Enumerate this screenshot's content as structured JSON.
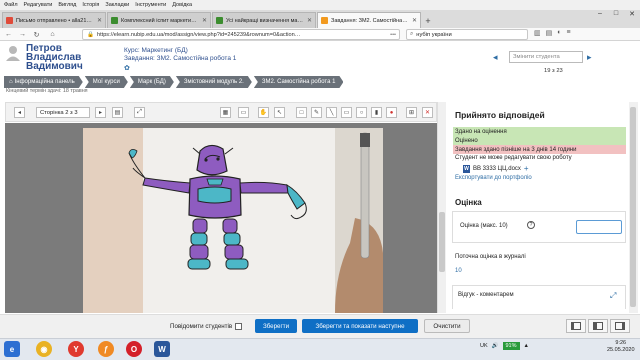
{
  "browser_menu": [
    "Файл",
    "Редагувати",
    "Вигляд",
    "Історія",
    "Закладки",
    "Інструменти",
    "Довідка"
  ],
  "tabs": [
    {
      "label": "Письмо отправлено • alla21…",
      "active": false,
      "favicon_color": "#e04b3a"
    },
    {
      "label": "Комплексний іспит маркетин…",
      "active": false,
      "favicon_color": "#3c8d2f"
    },
    {
      "label": "Усі найкращі визначення марк…",
      "active": false,
      "favicon_color": "#3c8d2f"
    },
    {
      "label": "Завдання: ЗМ2. Самостійна р…",
      "active": true,
      "favicon_color": "#f29a1f"
    }
  ],
  "window_controls": [
    "–",
    "□",
    "✕"
  ],
  "url": "https://elearn.nubip.edu.ua/mod/assign/view.php?id=245239&rownum=0&action…",
  "url_more": "•••",
  "search_text": "нубіп україни",
  "user": {
    "name": "Петров Владислав Вадимович"
  },
  "course_line": "Курс: Маркетинг (БД)",
  "task_line": "Завдання: ЗМ2. Самостійна робота 1",
  "student_select_placeholder": "Змінити студента",
  "page_counter": "19 з 23",
  "breadcrumbs": [
    "Інформаційна панель",
    "Мої курси",
    "Марк (БД)",
    "Змістовний модуль 2.",
    "ЗМ2. Самостійна робота 1"
  ],
  "cut_line": "Кінцевий термін здачі: 18 травня",
  "pdf_toolbar": {
    "page_label": "Сторінка 2 з 3"
  },
  "right_panel": {
    "title": "Прийнято відповідей",
    "status_submitted": "Здано на оцінення",
    "status_graded": "Оцінено",
    "status_late": "Завдання здано пізніше на 3 днів 14 години",
    "cannot_edit": "Студент не може редагувати свою роботу",
    "file_name": "ВВ 3333 ЦЦ.docx",
    "export_link": "Експортувати до портфоліо",
    "grade_title": "Оцінка",
    "grade_label": "Оцінка (макс. 10)",
    "current_grade_label": "Поточна оцінка в журналі",
    "current_grade_value": "10",
    "feedback_label": "Відгук - коментарем"
  },
  "bottom": {
    "notify_label": "Повідомити студентів",
    "save_label": "Зберегти",
    "save_next_label": "Зберегти та показати наступне",
    "reset_label": "Очистити"
  },
  "taskbar": {
    "apps": [
      "Internet Explorer",
      "Chrome",
      "Yandex",
      "Firefox",
      "Opera",
      "Word"
    ],
    "lang": "UK",
    "battery": "91%",
    "time": "9:26",
    "date": "25.05.2020"
  },
  "colors": {
    "primary_button": "#0f6fc5",
    "link": "#2e6da4",
    "status_ok": "#c8e6b5",
    "status_late": "#f2c1c1"
  }
}
